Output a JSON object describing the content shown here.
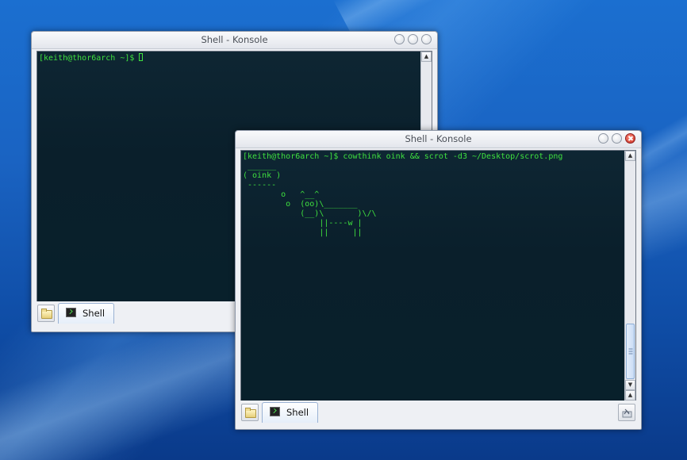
{
  "desktop": {
    "background_color": "#1a63c2"
  },
  "windows": [
    {
      "title": "Shell - Konsole",
      "terminal_lines": [
        "[keith@thor6arch ~]$ "
      ],
      "tab": {
        "label": "Shell"
      },
      "state": "inactive"
    },
    {
      "title": "Shell - Konsole",
      "terminal_lines": [
        "[keith@thor6arch ~]$ cowthink oink && scrot -d3 ~/Desktop/scrot.png",
        " ______",
        "( oink )",
        " ------",
        "        o   ^__^",
        "         o  (oo)\\_______",
        "            (__)\\       )\\/\\",
        "                ||----w |",
        "                ||     ||"
      ],
      "tab": {
        "label": "Shell"
      },
      "state": "active"
    }
  ],
  "icons": {
    "new_tab": "folder-icon",
    "tab": "terminal-icon",
    "close_tab": "close-tab-icon"
  },
  "colors": {
    "terminal_text": "#3fe03f",
    "terminal_bg": "#0a1f2b",
    "close_active": "#c62b1c"
  }
}
